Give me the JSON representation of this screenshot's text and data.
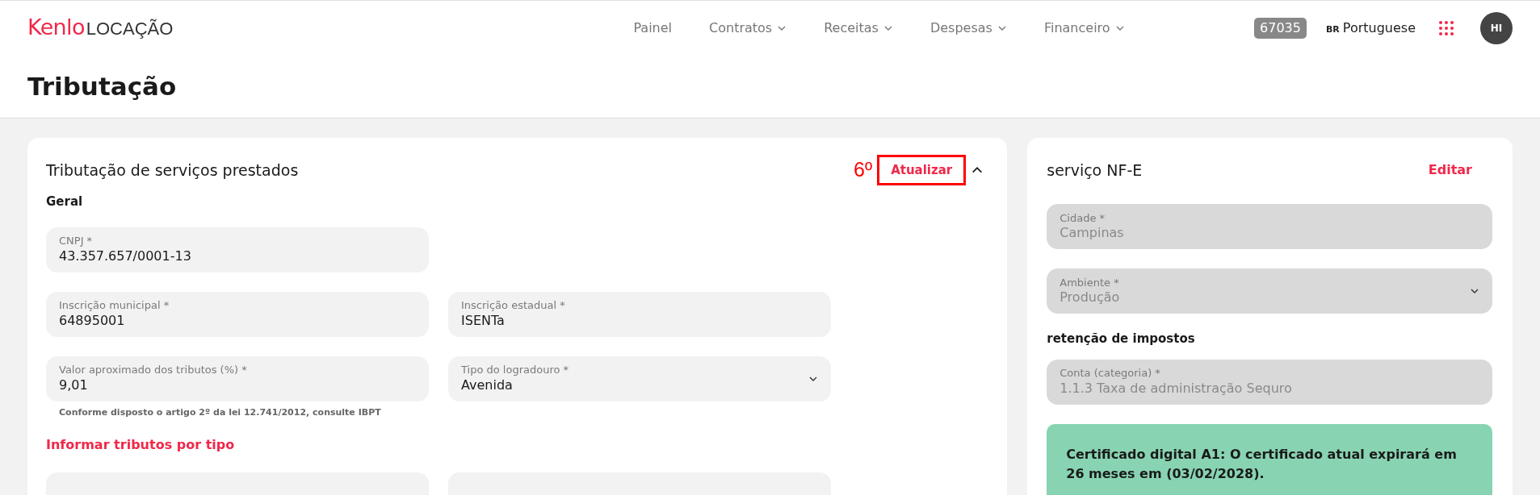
{
  "header": {
    "logo_brand": "Kenlo",
    "logo_product": "LOCAÇÃO",
    "nav": [
      {
        "label": "Painel",
        "dropdown": false
      },
      {
        "label": "Contratos",
        "dropdown": true
      },
      {
        "label": "Receitas",
        "dropdown": true
      },
      {
        "label": "Despesas",
        "dropdown": true
      },
      {
        "label": "Financeiro",
        "dropdown": true
      }
    ],
    "account_badge": "67035",
    "language_code": "BR",
    "language": "Portuguese",
    "avatar": "HI"
  },
  "page_title": "Tributação",
  "main_card": {
    "title": "Tributação de serviços prestados",
    "annotation": "6º",
    "action": "Atualizar",
    "expanded": true,
    "section": "Geral",
    "rows": [
      [
        {
          "kind": "text",
          "label": "CNPJ *",
          "value": "43.357.657/0001-13",
          "disabled": false
        }
      ],
      [
        {
          "kind": "text",
          "label": "Inscrição municipal *",
          "value": "64895001",
          "disabled": false
        },
        {
          "kind": "text",
          "label": "Inscrição estadual *",
          "value": "ISENTa",
          "disabled": false
        }
      ],
      [
        {
          "kind": "text",
          "label": "Valor aproximado dos tributos (%) *",
          "value": "9,01",
          "disabled": false,
          "hint": "Conforme disposto o artigo 2º da lei 12.741/2012, consulte IBPT"
        },
        {
          "kind": "select",
          "label": "Tipo do logradouro *",
          "value": "Avenida",
          "disabled": false
        }
      ]
    ],
    "link": "Informar tributos por tipo"
  },
  "side_card": {
    "title": "serviço NF-E",
    "action": "Editar",
    "fields": [
      {
        "kind": "text",
        "label": "Cidade *",
        "value": "Campinas",
        "disabled": true
      },
      {
        "kind": "select",
        "label": "Ambiente *",
        "value": "Produção",
        "disabled": true
      }
    ],
    "section": "retenção de impostos",
    "fields2": [
      {
        "kind": "text",
        "label": "Conta (categoria) *",
        "value": "1.1.3 Taxa de administração Sequro",
        "disabled": true
      }
    ],
    "notice": "Certificado digital A1: O certificado atual expirará em 26 meses em (03/02/2028)."
  }
}
